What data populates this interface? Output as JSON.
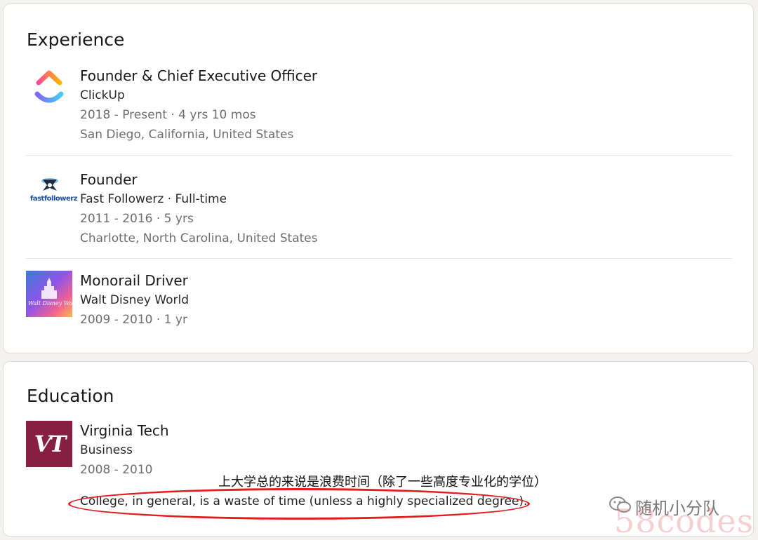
{
  "experience": {
    "title": "Experience",
    "items": [
      {
        "role": "Founder & Chief Executive Officer",
        "company": "ClickUp",
        "dates": "2018 - Present · 4 yrs 10 mos",
        "location": "San Diego, California, United States",
        "logo": "clickup-logo"
      },
      {
        "role": "Founder",
        "company": "Fast Followerz · Full-time",
        "dates": "2011 - 2016 · 5 yrs",
        "location": "Charlotte, North Carolina, United States",
        "logo": "fast-followerz-logo",
        "logo_text": "fastfollowerz"
      },
      {
        "role": "Monorail Driver",
        "company": "Walt Disney World",
        "dates": "2009 - 2010 · 1 yr",
        "logo": "walt-disney-world-logo",
        "logo_text": "Walt Disney World"
      }
    ]
  },
  "education": {
    "title": "Education",
    "items": [
      {
        "school": "Virginia Tech",
        "field": "Business",
        "dates": "2008 - 2010",
        "description": "College, in general, is a waste of time (unless a highly specialized degree).",
        "logo": "virginia-tech-logo",
        "logo_text": "VT"
      }
    ]
  },
  "annotation": {
    "chinese_note": "上大学总的来说是浪费时间（除了一些高度专业化的学位）",
    "highlight_color": "#e11d1d"
  },
  "watermark": {
    "account": "随机小分队",
    "site": "58codes"
  },
  "colors": {
    "vt_maroon": "#861f41",
    "clickup_pink": "#fd4b9a",
    "clickup_purple": "#7b68ee",
    "clickup_blue": "#49ccf9",
    "clickup_orange": "#ffb400"
  }
}
